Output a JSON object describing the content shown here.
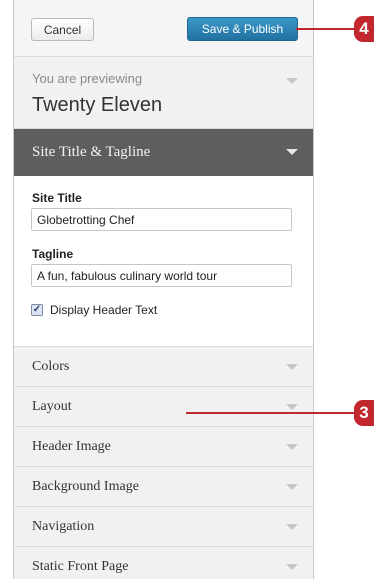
{
  "header": {
    "cancel_label": "Cancel",
    "publish_label": "Save & Publish"
  },
  "preview": {
    "label": "You are previewing",
    "theme_name": "Twenty Eleven"
  },
  "section": {
    "title": "Site Title & Tagline",
    "site_title_label": "Site Title",
    "site_title_value": "Globetrotting Chef",
    "tagline_label": "Tagline",
    "tagline_value": "A fun, fabulous culinary world tour",
    "display_header_text_label": "Display Header Text",
    "display_header_text_checked": true
  },
  "accordion": [
    {
      "label": "Colors"
    },
    {
      "label": "Layout"
    },
    {
      "label": "Header Image"
    },
    {
      "label": "Background Image"
    },
    {
      "label": "Navigation"
    },
    {
      "label": "Static Front Page"
    }
  ],
  "callouts": {
    "publish_step": "4",
    "layout_step": "3"
  },
  "colors": {
    "publish_button": "#2a80b0",
    "section_header": "#5e5e5e",
    "callout": "#c1272d"
  },
  "icons": [
    "chevron-down-icon",
    "check-icon"
  ]
}
